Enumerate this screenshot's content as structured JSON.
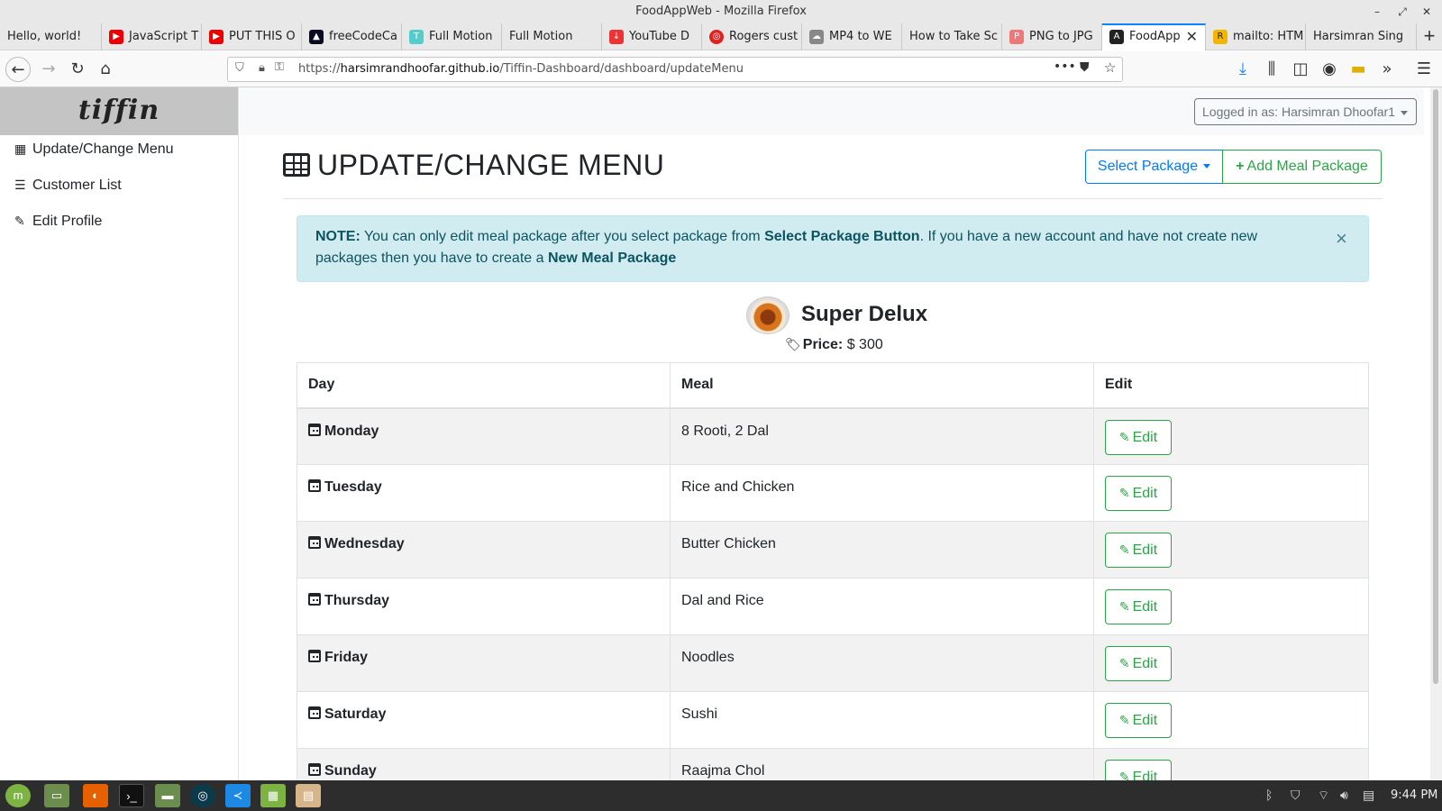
{
  "window": {
    "title": "FoodAppWeb - Mozilla Firefox"
  },
  "tabs": [
    {
      "label": "Hello, world!",
      "icon": "none"
    },
    {
      "label": "JavaScript T",
      "icon": "youtube-icon"
    },
    {
      "label": "PUT THIS O",
      "icon": "youtube-icon"
    },
    {
      "label": "freeCodeCa",
      "icon": "freecodecamp-icon"
    },
    {
      "label": "Full Motion",
      "icon": "t-icon"
    },
    {
      "label": "Full Motion",
      "icon": "none"
    },
    {
      "label": "YouTube D",
      "icon": "download-icon"
    },
    {
      "label": "Rogers cust",
      "icon": "rogers-icon"
    },
    {
      "label": "MP4 to WE",
      "icon": "cloud-icon"
    },
    {
      "label": "How to Take Sc",
      "icon": "none"
    },
    {
      "label": "PNG to JPG",
      "icon": "png-icon"
    },
    {
      "label": "FoodApp",
      "icon": "angular-icon"
    },
    {
      "label": "mailto: HTM",
      "icon": "r-icon"
    },
    {
      "label": "Harsimran Sing",
      "icon": "none"
    }
  ],
  "urlbar": {
    "prefix": "https://",
    "host": "harsimrandhoofar.github.io",
    "path": "/Tiffin-Dashboard/dashboard/updateMenu"
  },
  "sidebar": {
    "brand": "tiffin",
    "items": [
      {
        "label": "Update/Change Menu",
        "icon": "table-icon"
      },
      {
        "label": "Customer List",
        "icon": "list-icon"
      },
      {
        "label": "Edit Profile",
        "icon": "edit-icon"
      }
    ]
  },
  "header": {
    "user_label": "Logged in as: Harsimran Dhoofar1"
  },
  "main": {
    "title": "UPDATE/CHANGE MENU",
    "select_package_label": "Select Package",
    "add_package_label": "Add Meal Package",
    "alert": {
      "note_label": "NOTE:",
      "text1": " You can only edit meal package after you select package from ",
      "strong1": "Select Package Button",
      "text2": ". If you have a new account and have not create new packages then you have to create a ",
      "strong2": "New Meal Package",
      "close": "×"
    },
    "package": {
      "name": "Super Delux",
      "price_label": "Price:",
      "price_value": " $ 300"
    },
    "table": {
      "headers": [
        "Day",
        "Meal",
        "Edit"
      ],
      "edit_label": "Edit",
      "rows": [
        {
          "day": "Monday",
          "meal": "8 Rooti, 2 Dal"
        },
        {
          "day": "Tuesday",
          "meal": "Rice and Chicken"
        },
        {
          "day": "Wednesday",
          "meal": "Butter Chicken"
        },
        {
          "day": "Thursday",
          "meal": "Dal and Rice"
        },
        {
          "day": "Friday",
          "meal": "Noodles"
        },
        {
          "day": "Saturday",
          "meal": "Sushi"
        },
        {
          "day": "Sunday",
          "meal": "Raajma Chol"
        }
      ]
    }
  },
  "taskbar": {
    "clock": "9:44 PM"
  },
  "colors": {
    "primary": "#007bff",
    "success": "#28a745",
    "info_bg": "#d1ecf1",
    "info_text": "#0c5460"
  }
}
